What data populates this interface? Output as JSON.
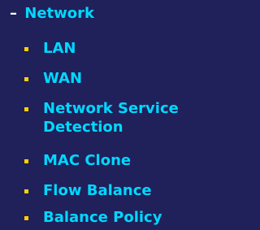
{
  "menu": {
    "section": {
      "toggle_symbol": "–",
      "label": "Network"
    },
    "items": [
      {
        "label": "LAN",
        "bullet_icon": "square-bullet-icon"
      },
      {
        "label": "WAN",
        "bullet_icon": "square-bullet-icon"
      },
      {
        "label": "Network Service Detection",
        "bullet_icon": "square-bullet-icon"
      },
      {
        "label": "MAC Clone",
        "bullet_icon": "square-bullet-icon"
      },
      {
        "label": "Flow Balance",
        "bullet_icon": "square-bullet-icon"
      },
      {
        "label": "Balance Policy",
        "bullet_icon": "square-bullet-icon"
      }
    ]
  },
  "colors": {
    "background": "#20205a",
    "link_text": "#00d8ff",
    "bullet": "#ffd000",
    "toggle": "#ffffff"
  }
}
